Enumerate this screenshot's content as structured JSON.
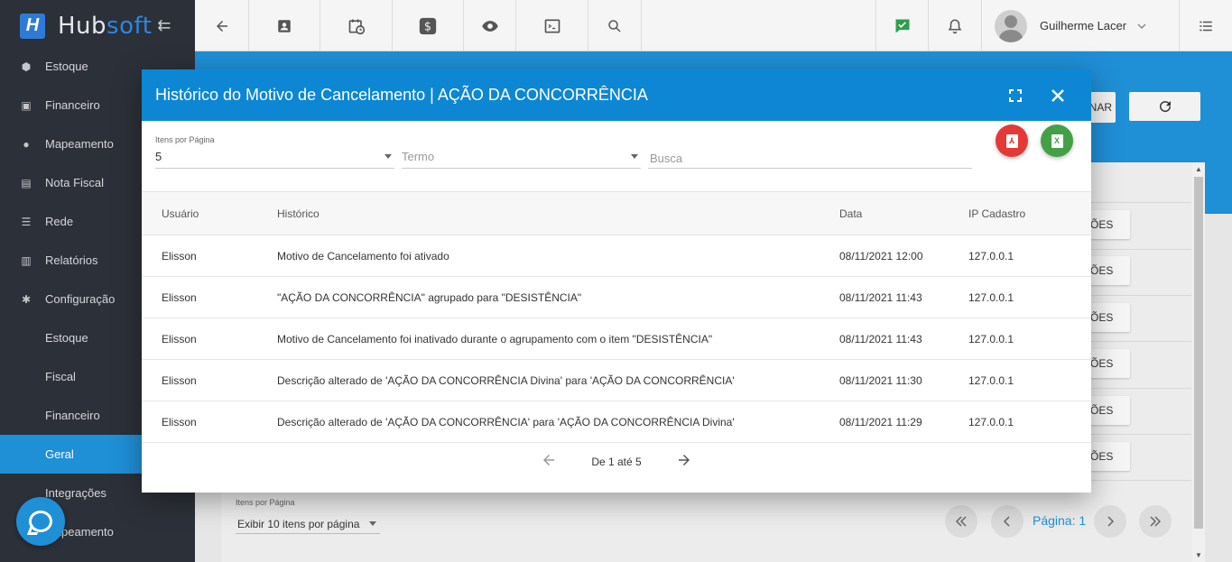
{
  "brand": {
    "logo_letter": "H",
    "name_a": "Hub",
    "name_b": "soft",
    "collapse_glyph": "⇇"
  },
  "sidebar": {
    "items": [
      {
        "label": "Estoque",
        "icon": "cube-icon",
        "glyph": "⬢"
      },
      {
        "label": "Financeiro",
        "icon": "money-icon",
        "glyph": "▣"
      },
      {
        "label": "Mapeamento",
        "icon": "map-pin-icon",
        "glyph": "●"
      },
      {
        "label": "Nota Fiscal",
        "icon": "file-icon",
        "glyph": "▤"
      },
      {
        "label": "Rede",
        "icon": "server-icon",
        "glyph": "☰"
      },
      {
        "label": "Relatórios",
        "icon": "report-icon",
        "glyph": "▥"
      },
      {
        "label": "Configuração",
        "icon": "gear-icon",
        "glyph": "✱"
      }
    ],
    "subitems": [
      {
        "label": "Estoque"
      },
      {
        "label": "Fiscal"
      },
      {
        "label": "Financeiro"
      },
      {
        "label": "Geral"
      },
      {
        "label": "Integrações"
      },
      {
        "label": "Mapeamento"
      }
    ]
  },
  "topbar": {
    "user_name": "Guilherme Lacer"
  },
  "background": {
    "btn_nar": "NAR",
    "row_btn_label": "ÕES",
    "per_page_label": "Itens por Página",
    "per_page_value": "Exibir 10 itens por página",
    "page_label": "Página: 1"
  },
  "modal": {
    "title": "Histórico do Motivo de Cancelamento | AÇÃO DA CONCORRÊNCIA",
    "filters": {
      "per_page_label": "Itens por Página",
      "per_page_value": "5",
      "term_placeholder": "Termo",
      "search_placeholder": "Busca"
    },
    "export": {
      "pdf_glyph": "⅄",
      "xls_glyph": "X"
    },
    "columns": [
      "Usuário",
      "Histórico",
      "Data",
      "IP Cadastro"
    ],
    "rows": [
      [
        "Elisson",
        "Motivo de Cancelamento foi ativado",
        "08/11/2021 12:00",
        "127.0.0.1"
      ],
      [
        "Elisson",
        "\"AÇÃO DA CONCORRÊNCIA\" agrupado para \"DESISTÊNCIA\"",
        "08/11/2021 11:43",
        "127.0.0.1"
      ],
      [
        "Elisson",
        "Motivo de Cancelamento foi inativado durante o agrupamento com o item \"DESISTÊNCIA\"",
        "08/11/2021 11:43",
        "127.0.0.1"
      ],
      [
        "Elisson",
        "Descrição alterado de 'AÇÃO DA CONCORRÊNCIA Divina' para 'AÇÃO DA CONCORRÊNCIA'",
        "08/11/2021 11:30",
        "127.0.0.1"
      ],
      [
        "Elisson",
        "Descrição alterado de 'AÇÃO DA CONCORRÊNCIA' para 'AÇÃO DA CONCORRÊNCIA Divina'",
        "08/11/2021 11:29",
        "127.0.0.1"
      ]
    ],
    "pager": "De 1 até 5"
  },
  "colors": {
    "primary": "#0d87d4",
    "sidebar_bg": "#2c3038",
    "pdf": "#e53935",
    "xls": "#43a047"
  }
}
